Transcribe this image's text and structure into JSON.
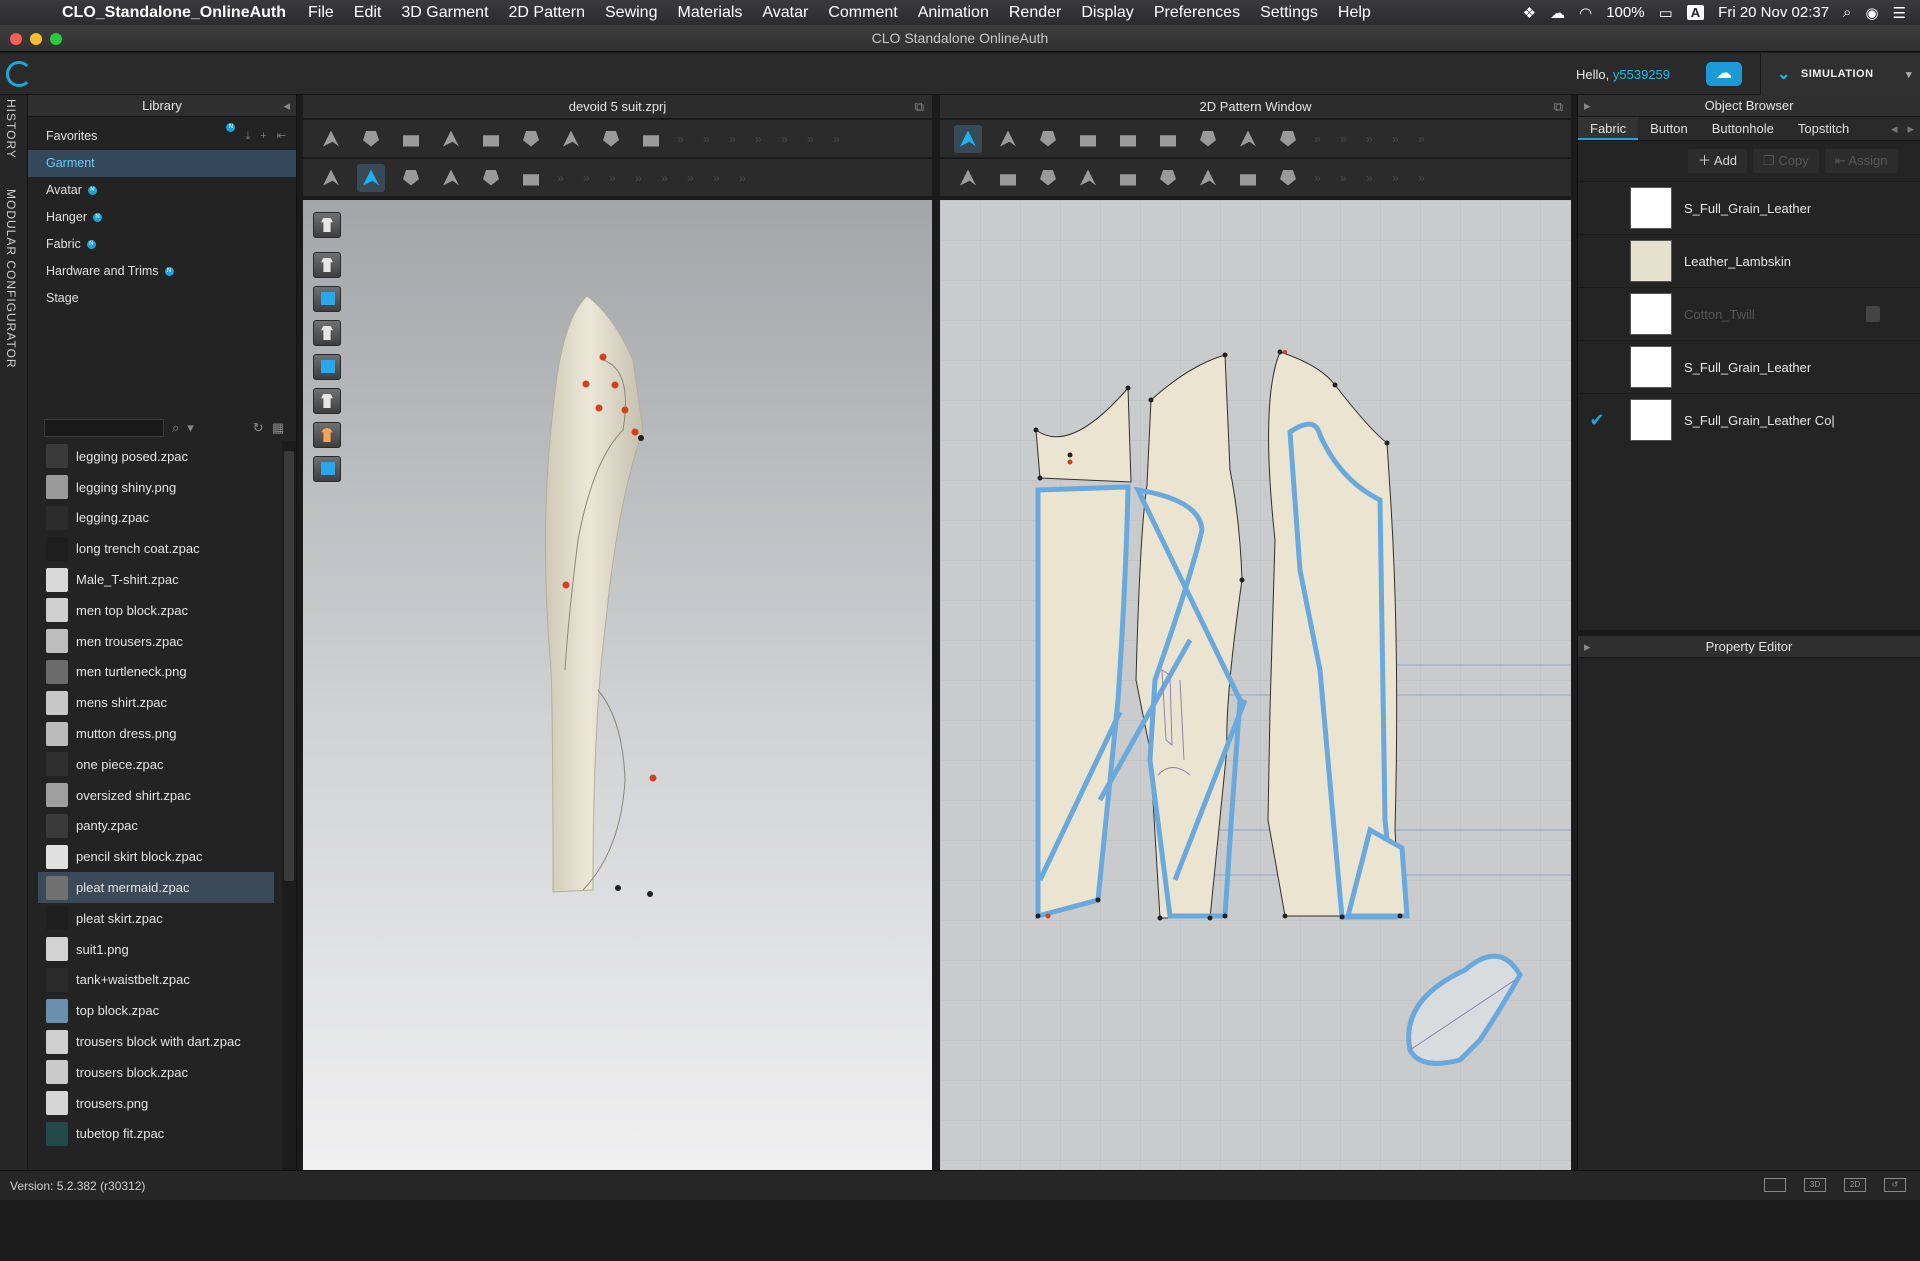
{
  "menubar": {
    "app": "CLO_Standalone_OnlineAuth",
    "items": [
      "File",
      "Edit",
      "3D Garment",
      "2D Pattern",
      "Sewing",
      "Materials",
      "Avatar",
      "Comment",
      "Animation",
      "Render",
      "Display",
      "Preferences",
      "Settings",
      "Help"
    ],
    "battery": "100%",
    "input_source": "A",
    "clock": "Fri 20 Nov  02:37"
  },
  "window_title": "CLO Standalone OnlineAuth",
  "topbar": {
    "hello_prefix": "Hello,",
    "user": "y5539259",
    "mode": "SIMULATION"
  },
  "left_tabs": [
    "HISTORY",
    "MODULAR CONFIGURATOR"
  ],
  "library": {
    "title": "Library",
    "categories": [
      {
        "label": "Favorites",
        "badge": "N"
      },
      {
        "label": "Garment",
        "badge": ""
      },
      {
        "label": "Avatar",
        "badge": "N"
      },
      {
        "label": "Hanger",
        "badge": "N"
      },
      {
        "label": "Fabric",
        "badge": "N"
      },
      {
        "label": "Hardware and Trims",
        "badge": "N"
      },
      {
        "label": "Stage",
        "badge": ""
      }
    ],
    "files": [
      "legging posed.zpac",
      "legging shiny.png",
      "legging.zpac",
      "long trench coat.zpac",
      "Male_T-shirt.zpac",
      "men top block.zpac",
      "men trousers.zpac",
      "men turtleneck.png",
      "mens shirt.zpac",
      "mutton dress.png",
      "one piece.zpac",
      "oversized shirt.zpac",
      "panty.zpac",
      "pencil skirt block.zpac",
      "pleat mermaid.zpac",
      "pleat skirt.zpac",
      "suit1.png",
      "tank+waistbelt.zpac",
      "top block.zpac",
      "trousers block with dart.zpac",
      "trousers block.zpac",
      "trousers.png",
      "tubetop fit.zpac"
    ],
    "selected_file": "pleat mermaid.zpac"
  },
  "viewport3d": {
    "title": "devoid 5 suit.zprj"
  },
  "viewport2d": {
    "title": "2D Pattern Window"
  },
  "object_browser": {
    "title": "Object Browser",
    "tabs": [
      "Fabric",
      "Button",
      "Buttonhole",
      "Topstitch"
    ],
    "actions": {
      "add": "Add",
      "copy": "Copy",
      "assign": "Assign"
    },
    "fabrics": [
      {
        "name": "S_Full_Grain_Leather",
        "color": "#ffffff",
        "checked": false,
        "dim": false
      },
      {
        "name": "Leather_Lambskin",
        "color": "#e6e0cf",
        "checked": false,
        "dim": false
      },
      {
        "name": "Cotton_Twill",
        "color": "#ffffff",
        "checked": false,
        "dim": true
      },
      {
        "name": "S_Full_Grain_Leather",
        "color": "#ffffff",
        "checked": false,
        "dim": false
      },
      {
        "name": "S_Full_Grain_Leather Co|",
        "color": "#ffffff",
        "checked": true,
        "dim": false
      }
    ]
  },
  "property_editor": {
    "title": "Property Editor"
  },
  "status": {
    "version": "Version: 5.2.382 (r30312)"
  },
  "colors": {
    "accent": "#1fa5d6",
    "pattern_fill": "#ebe4d1",
    "selection_outline": "#6aa9dc"
  }
}
